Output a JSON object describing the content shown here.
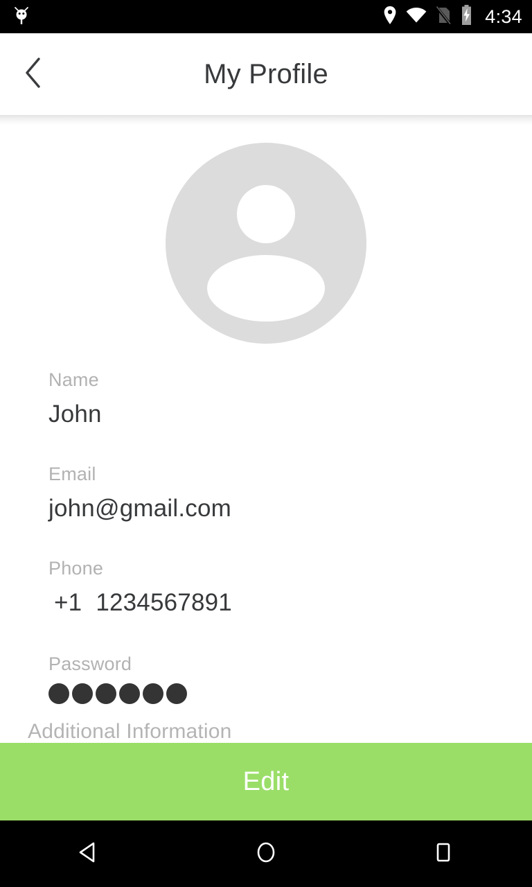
{
  "status_bar": {
    "notification_icon": "android-bug-icon",
    "icons": [
      "location-pin-icon",
      "wifi-icon",
      "no-sim-card-icon",
      "battery-charging-icon"
    ],
    "time": "4:34",
    "background_color": "#000000"
  },
  "app_bar": {
    "back_icon": "chevron-left-icon",
    "title": "My Profile"
  },
  "profile": {
    "avatar_icon": "person-avatar-placeholder-icon",
    "avatar_bg_color": "#dcdcdc",
    "fields": [
      {
        "label": "Name",
        "value": "John"
      },
      {
        "label": "Email",
        "value": "john@gmail.com"
      },
      {
        "label": "Phone",
        "value": "+1  1234567891",
        "country_code": "+1",
        "number": "1234567891"
      },
      {
        "label": "Password",
        "value": "●●●●●●",
        "masked": true,
        "dot_count": 6
      }
    ],
    "additional_section_title": "Additional Information"
  },
  "edit_button": {
    "label": "Edit",
    "background_color": "#9ADE68",
    "text_color": "#ffffff"
  },
  "nav_bar": {
    "back_icon": "nav-back-triangle-icon",
    "home_icon": "nav-home-circle-icon",
    "recents_icon": "nav-recents-square-icon"
  },
  "colors": {
    "label_gray": "#b2b2b2",
    "value_dark": "#37393b",
    "accent_green": "#9ADE68",
    "password_dot": "#343434"
  }
}
